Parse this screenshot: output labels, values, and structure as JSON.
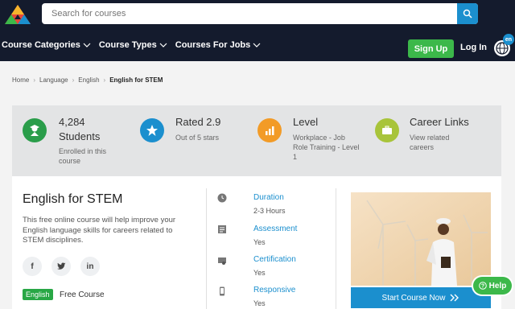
{
  "header": {
    "search_placeholder": "Search for courses",
    "nav": [
      "Course Categories",
      "Course Types",
      "Courses For Jobs"
    ],
    "signup_label": "Sign Up",
    "login_label": "Log In",
    "lang_code": "en"
  },
  "breadcrumb": [
    "Home",
    "Language",
    "English",
    "English for STEM"
  ],
  "stats": [
    {
      "title": "4,284",
      "title2": "Students",
      "sub": "Enrolled in this course",
      "icon": "graduate-icon",
      "color": "#2a9d4a"
    },
    {
      "title": "Rated 2.9",
      "sub": "Out of 5 stars",
      "icon": "star-icon",
      "color": "#1b8fce"
    },
    {
      "title": "Level",
      "sub": "Workplace - Job Role Training - Level 1",
      "icon": "chart-icon",
      "color": "#f29b27"
    },
    {
      "title": "Career Links",
      "sub": "View related careers",
      "icon": "briefcase-icon",
      "color": "#a8c43a"
    }
  ],
  "course": {
    "title": "English for STEM",
    "description": "This free online course will help improve your English language skills for careers related to STEM disciplines.",
    "language_badge": "English",
    "price_label": "Free Course"
  },
  "details": [
    {
      "label": "Duration",
      "value": "2-3 Hours",
      "icon": "clock-icon"
    },
    {
      "label": "Assessment",
      "value": "Yes",
      "icon": "assessment-icon"
    },
    {
      "label": "Certification",
      "value": "Yes",
      "icon": "certificate-icon"
    },
    {
      "label": "Responsive",
      "value": "Yes",
      "icon": "mobile-icon"
    }
  ],
  "cta": {
    "start_label": "Start Course Now"
  },
  "help_label": "Help",
  "colors": {
    "header_bg": "#141b2d",
    "accent_blue": "#1b8fce",
    "accent_green": "#3cb84a"
  }
}
